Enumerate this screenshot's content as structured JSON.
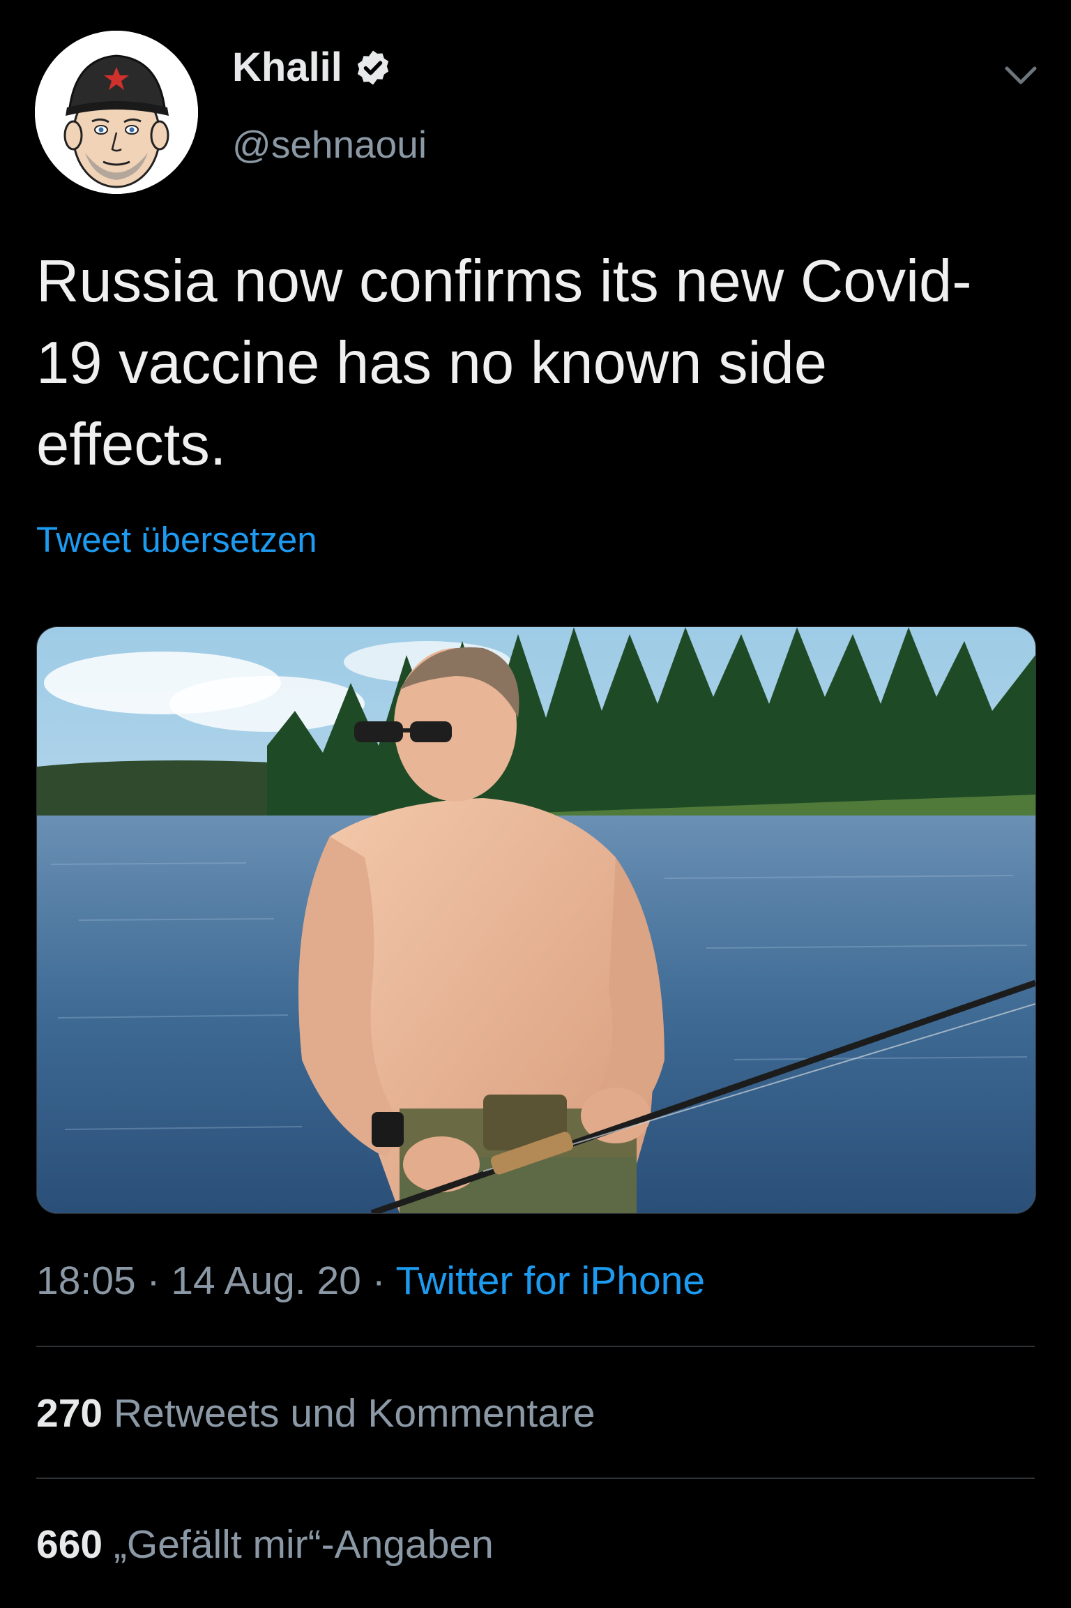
{
  "author": {
    "display_name": "Khalil",
    "handle": "@sehnaoui",
    "verified": true,
    "avatar_icon": "cartoon-avatar-cap-star"
  },
  "tweet": {
    "text": "Russia now confirms its new Covid-19 vaccine has no known side effects.",
    "translate_label": "Tweet übersetzen",
    "media": {
      "type": "photo",
      "scene": "shirtless man fishing in a lake with pine forest"
    }
  },
  "meta": {
    "time": "18:05",
    "separator": " · ",
    "date": "14 Aug. 20",
    "source": "Twitter for iPhone"
  },
  "stats": {
    "retweets_count": "270",
    "retweets_label": "Retweets und Kommentare",
    "likes_count": "660",
    "likes_label": "„Gefällt mir“-Angaben"
  },
  "colors": {
    "background": "#000000",
    "link_blue": "#1d9bf0",
    "secondary_text": "#8b98a5",
    "divider": "#2f3336"
  }
}
